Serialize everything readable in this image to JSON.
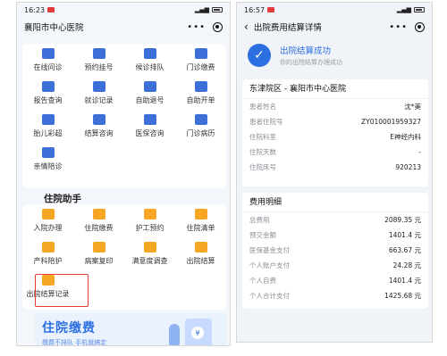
{
  "left": {
    "status": {
      "time": "16:23",
      "signal": "5ıl",
      "battery": ""
    },
    "nav": {
      "title": "襄阳市中心医院",
      "more": "•••"
    },
    "services": [
      {
        "label": "在线问诊",
        "icon": "chat-icon"
      },
      {
        "label": "预约挂号",
        "icon": "calendar-icon"
      },
      {
        "label": "候诊排队",
        "icon": "queue-icon"
      },
      {
        "label": "门诊缴费",
        "icon": "payment-icon"
      },
      {
        "label": "报告查询",
        "icon": "report-icon"
      },
      {
        "label": "就诊记录",
        "icon": "record-icon"
      },
      {
        "label": "自助退号",
        "icon": "refund-icon"
      },
      {
        "label": "自助开单",
        "icon": "order-icon"
      },
      {
        "label": "胎儿彩超",
        "icon": "ultrasound-icon"
      },
      {
        "label": "结算咨询",
        "icon": "consult-icon"
      },
      {
        "label": "医保咨询",
        "icon": "insurance-icon"
      },
      {
        "label": "门诊病历",
        "icon": "medical-record-icon"
      },
      {
        "label": "亲情陪诊",
        "icon": "companion-icon"
      }
    ],
    "inpatient_title": "住院助手",
    "inpatient": [
      {
        "label": "入院办理",
        "icon": "admission-icon"
      },
      {
        "label": "住院缴费",
        "icon": "deposit-icon"
      },
      {
        "label": "护工预约",
        "icon": "nurse-icon"
      },
      {
        "label": "住院清单",
        "icon": "list-icon"
      },
      {
        "label": "产科陪护",
        "icon": "obstetric-icon"
      },
      {
        "label": "病案复印",
        "icon": "copy-icon"
      },
      {
        "label": "满意度调查",
        "icon": "survey-icon"
      },
      {
        "label": "出院结算",
        "icon": "settlement-icon"
      },
      {
        "label": "出院结算记录",
        "icon": "settlement-record-icon"
      }
    ],
    "banner": {
      "title": "住院缴费",
      "subtitle": "缴费不排队 手机就搞定"
    }
  },
  "right": {
    "status": {
      "time": "16:57"
    },
    "nav": {
      "back": "‹",
      "title": "出院费用结算详情",
      "more": "•••"
    },
    "success": {
      "title": "出院结算成功",
      "subtitle": "你的出院结算办理成功"
    },
    "hospital": "东津院区 - 襄阳市中心医院",
    "patient_rows": [
      {
        "k": "患者姓名",
        "v": "沈*美"
      },
      {
        "k": "患者住院号",
        "v": "ZY010001959327"
      },
      {
        "k": "住院科室",
        "v": "E神经内科"
      },
      {
        "k": "住院天数",
        "v": "-"
      },
      {
        "k": "住院床号",
        "v": "920213"
      }
    ],
    "fee_title": "费用明细",
    "fee_rows": [
      {
        "k": "总费用",
        "v": "2089.35 元"
      },
      {
        "k": "预交金额",
        "v": "1401.4 元"
      },
      {
        "k": "医保基金支付",
        "v": "663.67 元"
      },
      {
        "k": "个人账户支付",
        "v": "24.28 元"
      },
      {
        "k": "个人自费",
        "v": "1401.4 元"
      },
      {
        "k": "个人合计支付",
        "v": "1425.68 元"
      }
    ]
  },
  "colors": {
    "accent": "#2c6fe0",
    "highlight": "#e53935",
    "orange": "#f5a623"
  }
}
